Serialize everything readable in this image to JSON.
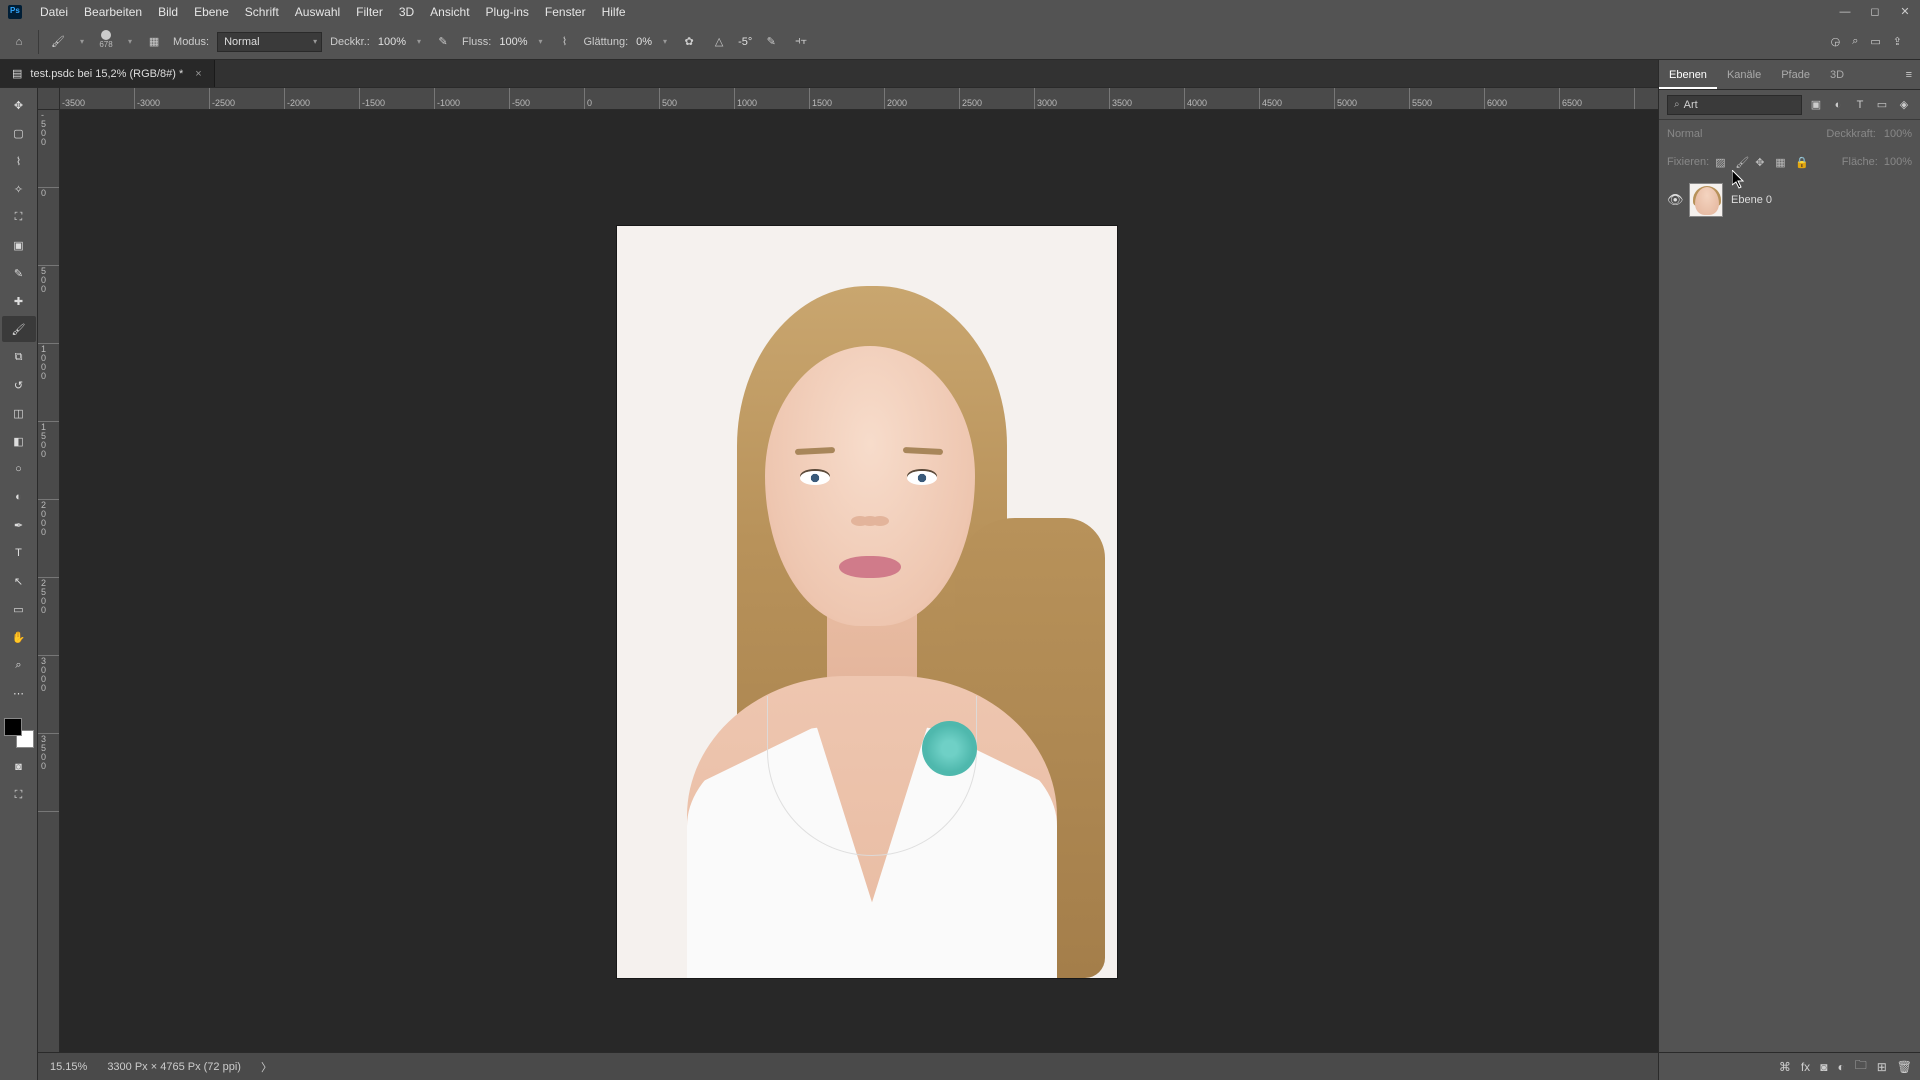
{
  "menu": [
    "Datei",
    "Bearbeiten",
    "Bild",
    "Ebene",
    "Schrift",
    "Auswahl",
    "Filter",
    "3D",
    "Ansicht",
    "Plug-ins",
    "Fenster",
    "Hilfe"
  ],
  "options": {
    "brush_size": "678",
    "mode_label": "Modus:",
    "mode_value": "Normal",
    "opacity_label": "Deckkr.:",
    "opacity_value": "100%",
    "flow_label": "Fluss:",
    "flow_value": "100%",
    "smooth_label": "Glättung:",
    "smooth_value": "0%",
    "angle_value": "-5°"
  },
  "document": {
    "tab_title": "test.psdc bei 15,2% (RGB/8#) *"
  },
  "ruler_h": [
    "-3500",
    "-3000",
    "-2500",
    "-2000",
    "-1500",
    "-1000",
    "-500",
    "0",
    "500",
    "1000",
    "1500",
    "2000",
    "2500",
    "3000",
    "3500",
    "4000",
    "4500",
    "5000",
    "5500",
    "6000",
    "6500"
  ],
  "ruler_v": [
    "-500",
    "0",
    "500",
    "1000",
    "1500",
    "2000",
    "2500",
    "3000",
    "3500"
  ],
  "panels": {
    "tabs": [
      "Ebenen",
      "Kanäle",
      "Pfade",
      "3D"
    ],
    "filter_label": "Art",
    "blend_mode": "Normal",
    "opacity_label": "Deckkraft:",
    "opacity_value": "100%",
    "lock_label": "Fixieren:",
    "fill_label": "Fläche:",
    "fill_value": "100%",
    "layer_name": "Ebene 0"
  },
  "status": {
    "zoom": "15.15%",
    "info": "3300 Px × 4765 Px (72 ppi)"
  },
  "tools": [
    "move",
    "marquee",
    "lasso",
    "crop",
    "frame",
    "eyedropper",
    "healing",
    "brush",
    "clone",
    "history",
    "eraser",
    "gradient",
    "dodge",
    "pen",
    "type",
    "path",
    "rectangle",
    "hand",
    "zoom",
    "more"
  ]
}
